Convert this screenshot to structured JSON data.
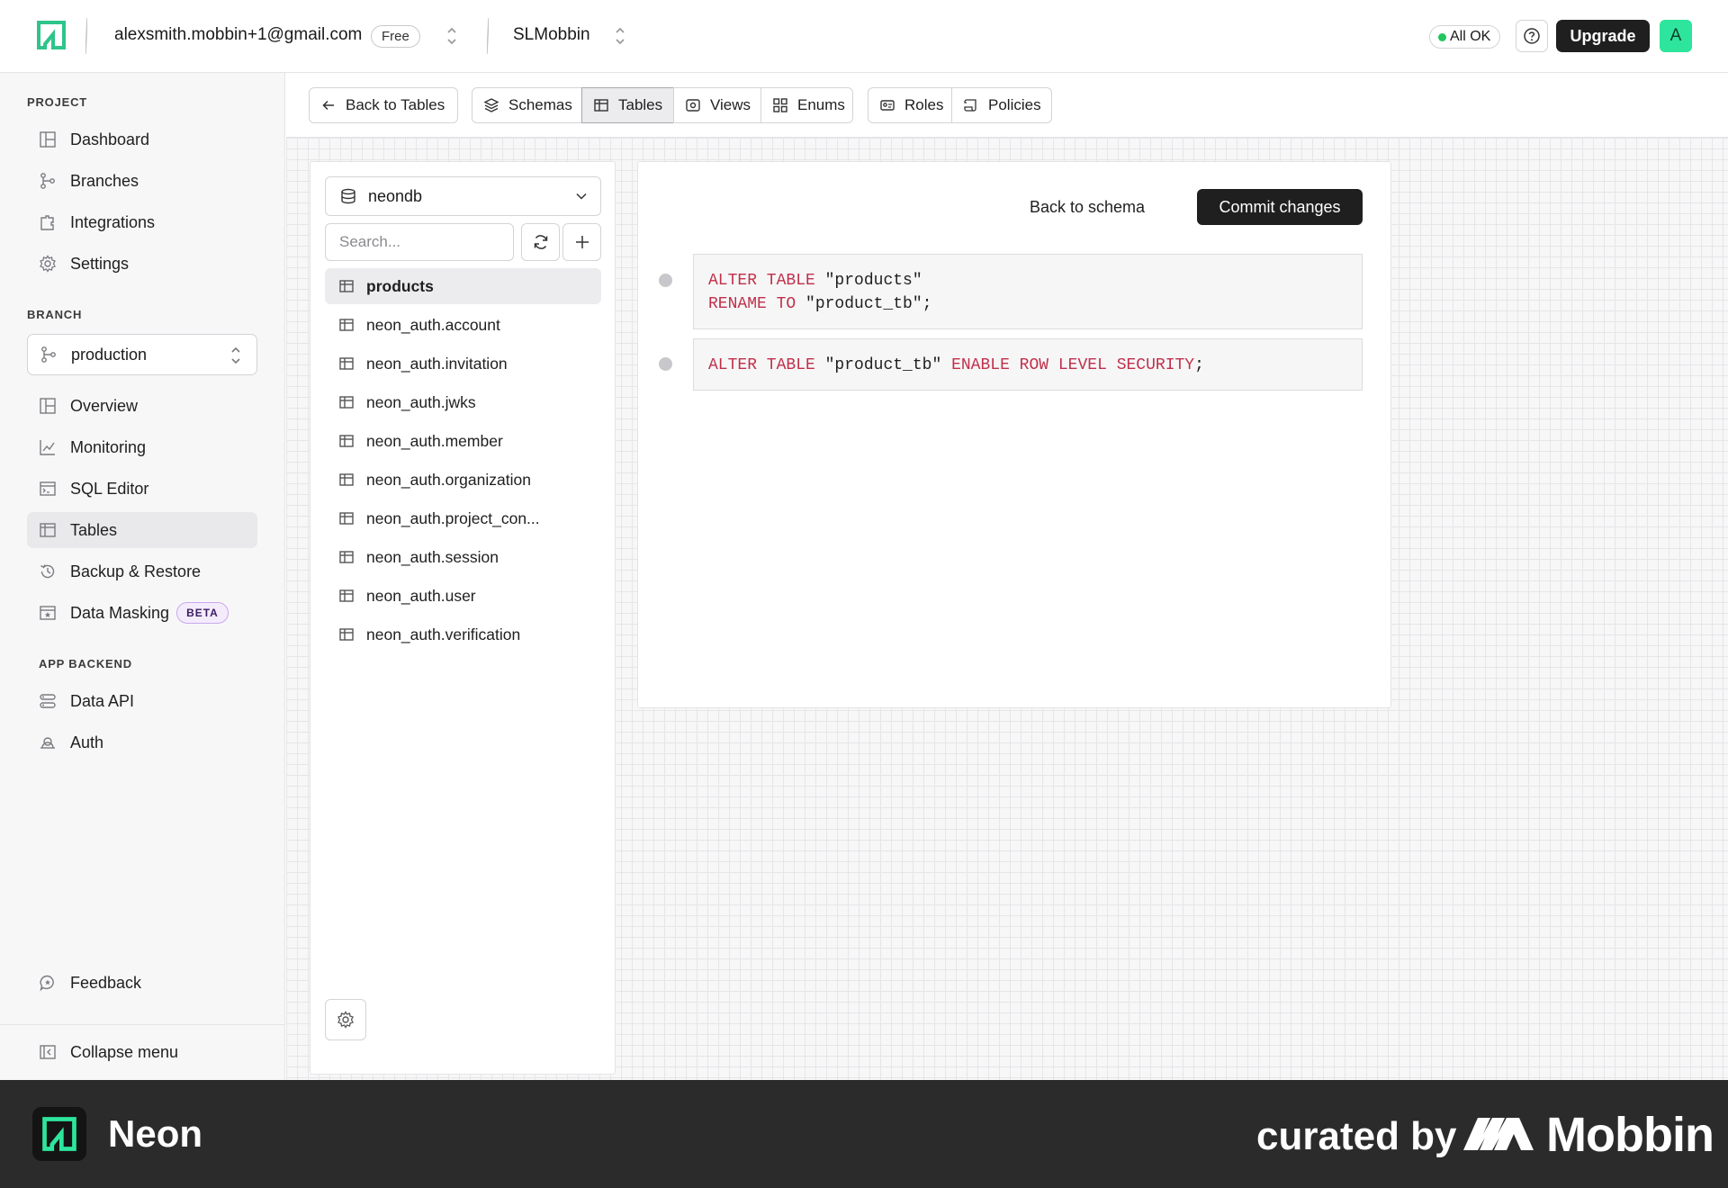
{
  "topbar": {
    "account_email": "alexsmith.mobbin+1@gmail.com",
    "plan_badge": "Free",
    "project_name": "SLMobbin",
    "status": "All OK",
    "upgrade_label": "Upgrade",
    "avatar_initial": "A"
  },
  "sidebar": {
    "project_section": "PROJECT",
    "project_items": [
      {
        "label": "Dashboard",
        "icon": "dashboard-icon"
      },
      {
        "label": "Branches",
        "icon": "branches-icon"
      },
      {
        "label": "Integrations",
        "icon": "integrations-icon"
      },
      {
        "label": "Settings",
        "icon": "gear-icon"
      }
    ],
    "branch_section": "BRANCH",
    "branch_selected": "production",
    "branch_items": [
      {
        "label": "Overview",
        "icon": "overview-icon"
      },
      {
        "label": "Monitoring",
        "icon": "monitoring-icon"
      },
      {
        "label": "SQL Editor",
        "icon": "sql-editor-icon"
      },
      {
        "label": "Tables",
        "icon": "table-icon",
        "active": true
      },
      {
        "label": "Backup & Restore",
        "icon": "history-icon"
      },
      {
        "label": "Data Masking",
        "icon": "data-masking-icon",
        "badge": "BETA"
      }
    ],
    "app_backend_section": "APP BACKEND",
    "app_backend_items": [
      {
        "label": "Data API",
        "icon": "data-api-icon"
      },
      {
        "label": "Auth",
        "icon": "auth-icon"
      }
    ],
    "feedback_label": "Feedback",
    "collapse_label": "Collapse menu"
  },
  "toolbar": {
    "back_to_tables": "Back to Tables",
    "schemas": "Schemas",
    "tables": "Tables",
    "views": "Views",
    "enums": "Enums",
    "roles": "Roles",
    "policies": "Policies"
  },
  "table_panel": {
    "database": "neondb",
    "search_placeholder": "Search...",
    "tables": [
      "products",
      "neon_auth.account",
      "neon_auth.invitation",
      "neon_auth.jwks",
      "neon_auth.member",
      "neon_auth.organization",
      "neon_auth.project_con...",
      "neon_auth.session",
      "neon_auth.user",
      "neon_auth.verification"
    ],
    "active_table": "products"
  },
  "changes": {
    "back_to_schema": "Back to schema",
    "commit_label": "Commit changes",
    "statements": [
      {
        "kw1": "ALTER TABLE",
        "v1": " \"products\"",
        "kw2": "RENAME TO",
        "v2": " \"product_tb\";"
      },
      {
        "kw1": "ALTER TABLE",
        "v1": " \"product_tb\" ",
        "kw2": "ENABLE ROW LEVEL SECURITY",
        "v2": ";"
      }
    ]
  },
  "footer": {
    "brand": "Neon",
    "curated_by": "curated by",
    "curator": "Mobbin"
  },
  "colors": {
    "accent_green": "#2ee59d",
    "keyword_red": "#c0304a",
    "dark_button": "#1f1f1f",
    "footer_bg": "#2b2b2b"
  }
}
